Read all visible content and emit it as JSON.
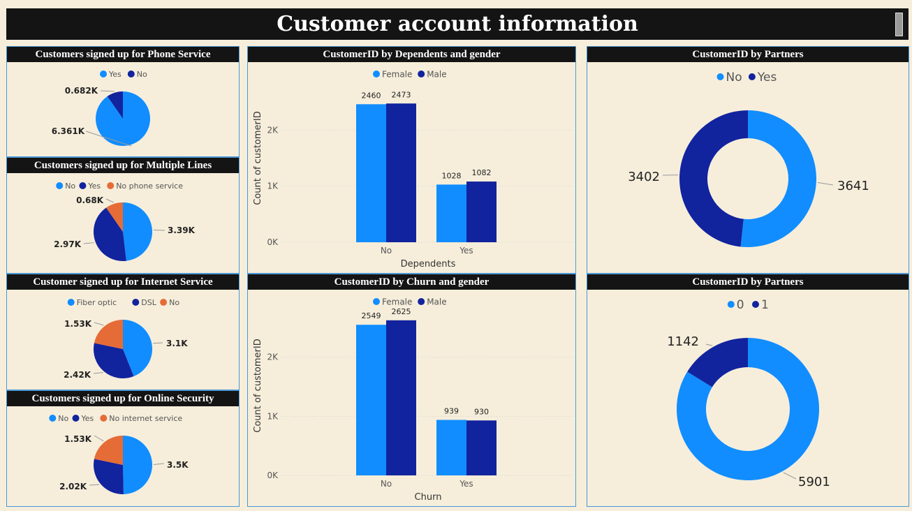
{
  "header": {
    "title": "Customer account information"
  },
  "colors": {
    "light_blue": "#118dff",
    "dark_blue": "#12239e",
    "orange": "#e66c37"
  },
  "panels": {
    "phone": {
      "title": "Customers signed up for Phone Service",
      "legend": [
        "Yes",
        "No"
      ]
    },
    "multiple_lines": {
      "title": "Customers signed up for Multiple Lines",
      "legend": [
        "No",
        "Yes",
        "No phone service"
      ]
    },
    "internet": {
      "title": "Customer signed up for Internet Service",
      "legend": [
        "Fiber optic",
        "DSL",
        "No"
      ]
    },
    "security": {
      "title": "Customers signed up for Online Security",
      "legend": [
        "No",
        "Yes",
        "No internet service"
      ]
    },
    "dependents": {
      "title": "CustomerID by Dependents and gender",
      "legend": [
        "Female",
        "Male"
      ]
    },
    "churn": {
      "title": "CustomerID by Churn and gender",
      "legend": [
        "Female",
        "Male"
      ]
    },
    "partners": {
      "title": "CustomerID by Partners",
      "legend": [
        "No",
        "Yes"
      ]
    },
    "churn_donut": {
      "title": "CustomerID by Partners",
      "legend": [
        "0",
        "1"
      ]
    }
  },
  "chart_data": [
    {
      "id": "phone",
      "type": "pie",
      "title": "Customers signed up for Phone Service",
      "categories": [
        "Yes",
        "No"
      ],
      "values": [
        6361,
        682
      ],
      "labels": [
        "6.361K",
        "0.682K"
      ]
    },
    {
      "id": "multiple_lines",
      "type": "pie",
      "title": "Customers signed up for Multiple Lines",
      "categories": [
        "No",
        "Yes",
        "No phone service"
      ],
      "values": [
        3390,
        2970,
        680
      ],
      "labels": [
        "3.39K",
        "2.97K",
        "0.68K"
      ]
    },
    {
      "id": "internet",
      "type": "pie",
      "title": "Customer signed up for Internet Service",
      "categories": [
        "Fiber optic",
        "DSL",
        "No"
      ],
      "values": [
        3100,
        2420,
        1530
      ],
      "labels": [
        "3.1K",
        "2.42K",
        "1.53K"
      ]
    },
    {
      "id": "security",
      "type": "pie",
      "title": "Customers signed up for Online Security",
      "categories": [
        "No",
        "Yes",
        "No internet service"
      ],
      "values": [
        3500,
        2020,
        1530
      ],
      "labels": [
        "3.5K",
        "2.02K",
        "1.53K"
      ]
    },
    {
      "id": "dependents",
      "type": "bar",
      "title": "CustomerID by Dependents and gender",
      "xlabel": "Dependents",
      "ylabel": "Count of customerID",
      "categories": [
        "No",
        "Yes"
      ],
      "series": [
        {
          "name": "Female",
          "values": [
            2460,
            1028
          ]
        },
        {
          "name": "Male",
          "values": [
            2473,
            1082
          ]
        }
      ],
      "yticks": [
        "0K",
        "1K",
        "2K"
      ],
      "ylim": [
        0,
        2750
      ],
      "grid": true
    },
    {
      "id": "churn",
      "type": "bar",
      "title": "CustomerID by Churn and gender",
      "xlabel": "Churn",
      "ylabel": "Count of customerID",
      "categories": [
        "No",
        "Yes"
      ],
      "series": [
        {
          "name": "Female",
          "values": [
            2549,
            939
          ]
        },
        {
          "name": "Male",
          "values": [
            2625,
            930
          ]
        }
      ],
      "yticks": [
        "0K",
        "1K",
        "2K"
      ],
      "ylim": [
        0,
        2800
      ],
      "grid": true
    },
    {
      "id": "partners",
      "type": "pie",
      "donut": true,
      "title": "CustomerID by Partners",
      "categories": [
        "No",
        "Yes"
      ],
      "values": [
        3641,
        3402
      ],
      "labels": [
        "3641",
        "3402"
      ]
    },
    {
      "id": "churn_donut",
      "type": "pie",
      "donut": true,
      "title": "CustomerID by Partners",
      "categories": [
        "0",
        "1"
      ],
      "values": [
        5901,
        1142
      ],
      "labels": [
        "5901",
        "1142"
      ]
    }
  ]
}
